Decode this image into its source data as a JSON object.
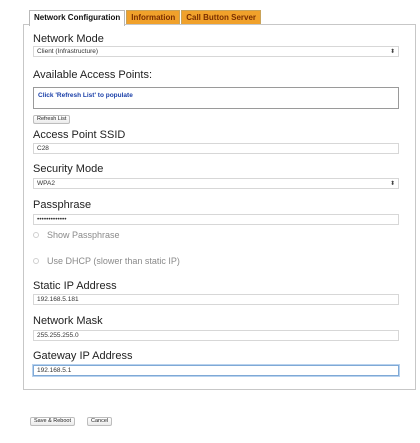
{
  "tabs": [
    {
      "label": "Network Configuration"
    },
    {
      "label": "Information"
    },
    {
      "label": "Call Button Server"
    }
  ],
  "network_mode": {
    "label": "Network Mode",
    "value": "Client (Infrastructure)"
  },
  "access_points": {
    "label": "Available Access Points:",
    "hint": "Click 'Refresh List' to populate",
    "refresh_label": "Refresh List"
  },
  "ssid": {
    "label": "Access Point SSID",
    "value": "C28"
  },
  "security_mode": {
    "label": "Security Mode",
    "value": "WPA2"
  },
  "passphrase": {
    "label": "Passphrase",
    "value": "•••••••••••••",
    "show_label": "Show Passphrase"
  },
  "dhcp": {
    "label": "Use DHCP (slower than static IP)"
  },
  "static_ip": {
    "label": "Static IP Address",
    "value": "192.168.5.181"
  },
  "netmask": {
    "label": "Network Mask",
    "value": "255.255.255.0"
  },
  "gateway": {
    "label": "Gateway IP Address",
    "value": "192.168.5.1"
  },
  "actions": {
    "save_label": "Save & Reboot",
    "cancel_label": "Cancel"
  },
  "icons": {
    "select_arrows": "updown-arrows-icon"
  },
  "colors": {
    "tab_active_bg": "#ffffff",
    "tab_inactive_bg": "#f0a12b",
    "hint_text": "#1a3fa8",
    "focus_border": "#7fa9d6"
  }
}
